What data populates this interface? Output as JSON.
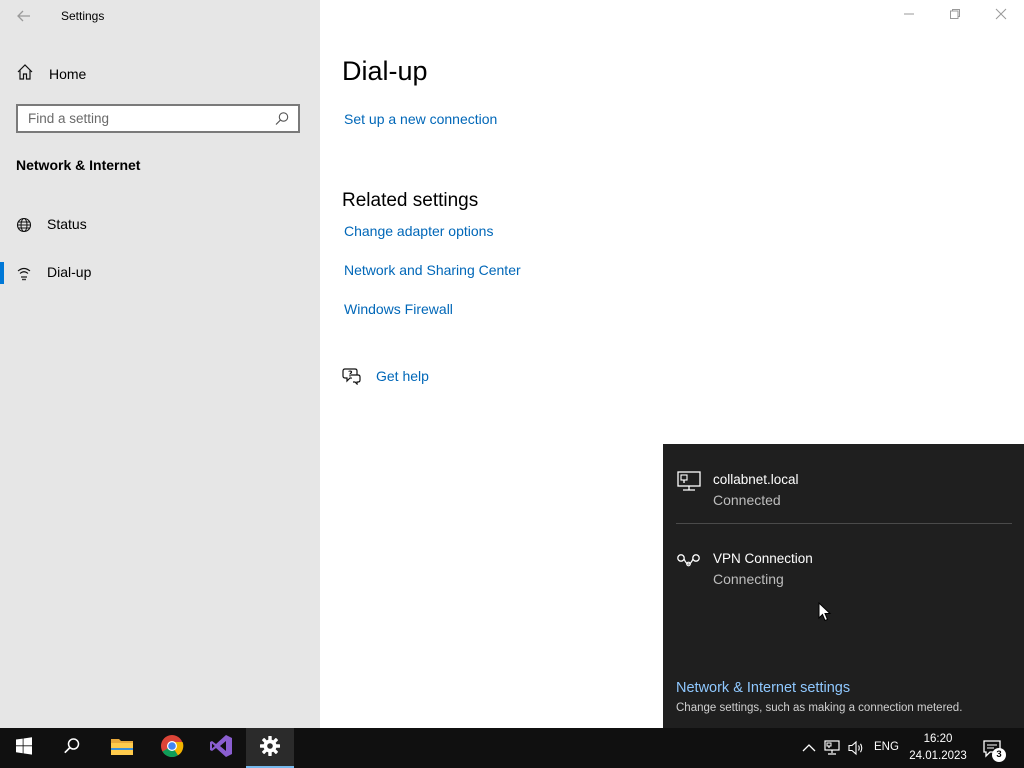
{
  "window": {
    "title": "Settings",
    "controls": [
      "minimize",
      "restore",
      "close"
    ]
  },
  "sidebar": {
    "home_label": "Home",
    "search_placeholder": "Find a setting",
    "section_title": "Network & Internet",
    "items": [
      {
        "label": "Status",
        "icon": "globe-icon"
      },
      {
        "label": "Dial-up",
        "icon": "dialup-icon",
        "active": true
      }
    ]
  },
  "main": {
    "title": "Dial-up",
    "setup_link": "Set up a new connection",
    "related_heading": "Related settings",
    "related_links": [
      "Change adapter options",
      "Network and Sharing Center",
      "Windows Firewall"
    ],
    "help_label": "Get help"
  },
  "flyout": {
    "networks": [
      {
        "name": "collabnet.local",
        "status": "Connected",
        "icon": "ethernet-icon"
      },
      {
        "name": "VPN Connection",
        "status": "Connecting",
        "icon": "vpn-icon"
      }
    ],
    "settings_link": "Network & Internet settings",
    "settings_desc": "Change settings, such as making a connection metered."
  },
  "taskbar": {
    "apps": [
      "windows-start",
      "search",
      "file-explorer",
      "chrome",
      "visual-studio",
      "settings"
    ],
    "active_app": "settings",
    "language": "ENG",
    "time": "16:20",
    "date": "24.01.2023",
    "notification_count": "3"
  },
  "colors": {
    "accent": "#0078d7",
    "link": "#0067b8",
    "sidebar_bg": "#e6e6e6",
    "flyout_bg": "#1f1f1f",
    "flyout_link": "#8fc8ff",
    "taskbar_bg": "#101010"
  }
}
